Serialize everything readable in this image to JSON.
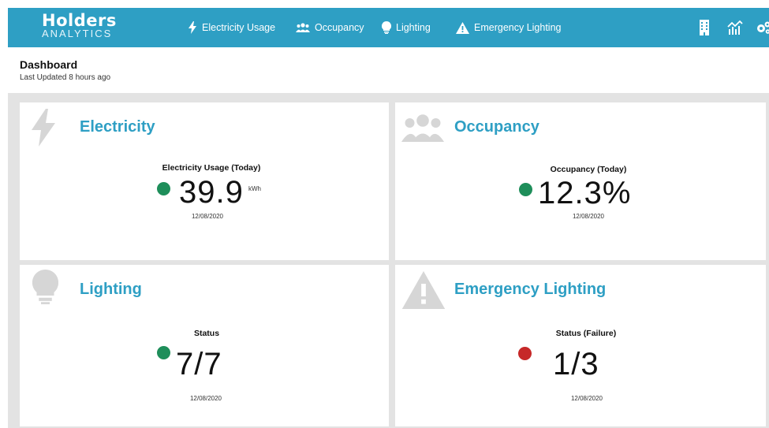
{
  "brand": {
    "name": "Holders",
    "subtitle": "ANALYTICS"
  },
  "nav": [
    {
      "label": "Electricity Usage",
      "icon": "bolt-icon"
    },
    {
      "label": "Occupancy",
      "icon": "users-icon"
    },
    {
      "label": "Lighting",
      "icon": "lightbulb-icon"
    },
    {
      "label": "Emergency Lighting",
      "icon": "warning-icon"
    }
  ],
  "toolbar": [
    {
      "icon": "building-icon"
    },
    {
      "icon": "analytics-chart-icon"
    },
    {
      "icon": "settings-gears-icon"
    }
  ],
  "page": {
    "title": "Dashboard",
    "last_updated": "Last Updated 8 hours ago"
  },
  "cards": {
    "electricity": {
      "title": "Electricity",
      "label": "Electricity Usage (Today)",
      "value": "39.9",
      "unit": "kWh",
      "date": "12/08/2020",
      "status_color": "#1e8e5a",
      "icon": "bolt-icon"
    },
    "occupancy": {
      "title": "Occupancy",
      "label": "Occupancy (Today)",
      "value": "12.3%",
      "date": "12/08/2020",
      "status_color": "#1e8e5a",
      "icon": "users-icon"
    },
    "lighting": {
      "title": "Lighting",
      "label": "Status",
      "value": "7/7",
      "date": "12/08/2020",
      "status_color": "#1e8e5a",
      "icon": "lightbulb-icon"
    },
    "emergency": {
      "title": "Emergency Lighting",
      "label": "Status (Failure)",
      "value": "1/3",
      "date": "12/08/2020",
      "status_color": "#c62828",
      "icon": "warning-icon"
    }
  },
  "colors": {
    "accent": "#2e9fc4",
    "ok": "#1e8e5a",
    "fail": "#c62828",
    "panel_bg": "#e3e3e3"
  }
}
